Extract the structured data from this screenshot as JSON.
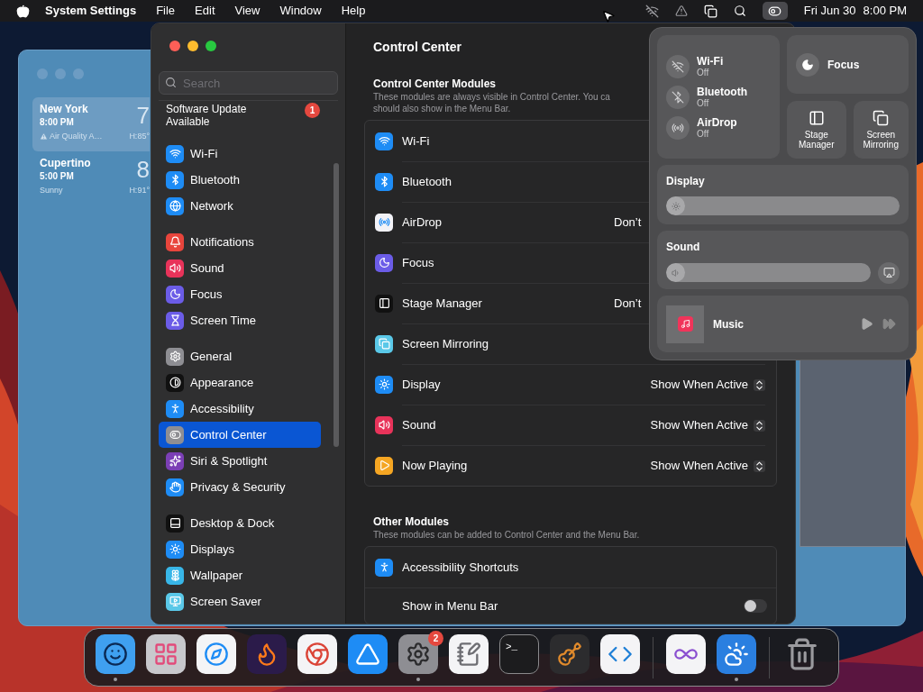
{
  "menu_bar": {
    "app_name": "System Settings",
    "menus": [
      "File",
      "Edit",
      "View",
      "Window",
      "Help"
    ],
    "date": "Fri Jun 30",
    "time": "8:00 PM",
    "control_center_active": true
  },
  "weather_window": {
    "cities": [
      {
        "name": "New York",
        "time": "8:00 PM",
        "condition": "Air Quality A…",
        "alert": true,
        "temperature": "7",
        "high": "H:85°",
        "selected": true
      },
      {
        "name": "Cupertino",
        "time": "5:00 PM",
        "condition": "Sunny",
        "alert": false,
        "temperature": "8",
        "high": "H:91°",
        "selected": false
      }
    ]
  },
  "settings_window": {
    "sidebar": {
      "search": {
        "placeholder": "Search"
      },
      "update": {
        "label": "Software Update Available",
        "badge": "1"
      },
      "groups": [
        {
          "items": [
            {
              "label": "Wi-Fi",
              "selected": false,
              "color": "#1e8cf5"
            },
            {
              "label": "Bluetooth",
              "selected": false,
              "color": "#1e8cf5"
            },
            {
              "label": "Network",
              "selected": false,
              "color": "#1e8cf5"
            }
          ]
        },
        {
          "items": [
            {
              "label": "Notifications",
              "selected": false,
              "color": "#e8453c"
            },
            {
              "label": "Sound",
              "selected": false,
              "color": "#e8335a"
            },
            {
              "label": "Focus",
              "selected": false,
              "color": "#6b5ce7"
            },
            {
              "label": "Screen Time",
              "selected": false,
              "color": "#6b5ce7"
            }
          ]
        },
        {
          "items": [
            {
              "label": "General",
              "selected": false,
              "color": "#8e8e93"
            },
            {
              "label": "Appearance",
              "selected": false,
              "color": "#111111"
            },
            {
              "label": "Accessibility",
              "selected": false,
              "color": "#1e8cf5"
            },
            {
              "label": "Control Center",
              "selected": true,
              "color": "#8e8e93"
            },
            {
              "label": "Siri & Spotlight",
              "selected": false,
              "color": "#7b3fb5"
            },
            {
              "label": "Privacy & Security",
              "selected": false,
              "color": "#1e8cf5"
            }
          ]
        },
        {
          "items": [
            {
              "label": "Desktop & Dock",
              "selected": false,
              "color": "#111111"
            },
            {
              "label": "Displays",
              "selected": false,
              "color": "#1e8cf5"
            },
            {
              "label": "Wallpaper",
              "selected": false,
              "color": "#38b6e8"
            },
            {
              "label": "Screen Saver",
              "selected": false,
              "color": "#5ac8e8"
            }
          ]
        }
      ]
    },
    "title": "Control Center",
    "sections": [
      {
        "title": "Control Center Modules",
        "description_lines": [
          "These modules are always visible in Control Center. You ca",
          "should also show in the Menu Bar."
        ],
        "modules": [
          {
            "label": "Wi-Fi",
            "color": "#1e8cf5"
          },
          {
            "label": "Bluetooth",
            "color": "#1e8cf5"
          },
          {
            "label": "AirDrop",
            "color": "#f2f2f7",
            "value": "Don’t",
            "stepper": false
          },
          {
            "label": "Focus",
            "color": "#6b5ce7"
          },
          {
            "label": "Stage Manager",
            "color": "#111111",
            "value": "Don’t",
            "stepper": false
          },
          {
            "label": "Screen Mirroring",
            "color": "#5ac8e8"
          },
          {
            "label": "Display",
            "color": "#1e8cf5",
            "value": "Show When Active",
            "stepper": true
          },
          {
            "label": "Sound",
            "color": "#e8335a",
            "value": "Show When Active",
            "stepper": true
          },
          {
            "label": "Now Playing",
            "color": "#f5a623",
            "value": "Show When Active",
            "stepper": true
          }
        ]
      },
      {
        "title": "Other Modules",
        "description_lines": [
          "These modules can be added to Control Center and the Menu Bar."
        ],
        "modules": [
          {
            "label": "Accessibility Shortcuts",
            "color": "#1e8cf5"
          }
        ],
        "toggle": {
          "label": "Show in Menu Bar",
          "on": false
        }
      }
    ]
  },
  "control_center": {
    "connectivity": [
      {
        "label": "Wi-Fi",
        "status": "Off",
        "on": false
      },
      {
        "label": "Bluetooth",
        "status": "Off",
        "on": false
      },
      {
        "label": "AirDrop",
        "status": "Off",
        "on": false
      }
    ],
    "focus": "Focus",
    "stage_manager": "Stage Manager",
    "screen_mirroring": "Screen Mirroring",
    "display": {
      "label": "Display",
      "level": 0.05
    },
    "sound": {
      "label": "Sound",
      "level": 0.05
    },
    "now_playing": {
      "app": "Music"
    }
  },
  "dock": {
    "apps": [
      {
        "running": true
      },
      {
        "running": false
      },
      {
        "running": false
      },
      {
        "running": false
      },
      {
        "running": false
      },
      {
        "running": false
      },
      {
        "running": true,
        "badge": "2"
      },
      {
        "running": false
      },
      {
        "running": false,
        "label": ">_"
      },
      {
        "running": false
      },
      {
        "running": false
      },
      {
        "running": false
      },
      {
        "running": true
      },
      {
        "running": false
      }
    ]
  }
}
